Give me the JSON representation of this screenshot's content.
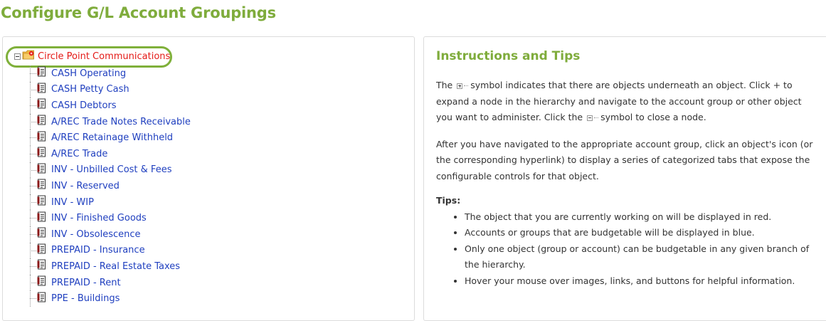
{
  "page": {
    "title": "Configure G/L Account Groupings"
  },
  "tree": {
    "root_label": "Circle Point Communications",
    "items": [
      "CASH Operating",
      "CASH Petty Cash",
      "CASH Debtors",
      "A/REC Trade Notes Receivable",
      "A/REC Retainage Withheld",
      "A/REC Trade",
      "INV - Unbilled Cost & Fees",
      "INV - Reserved",
      "INV - WIP",
      "INV - Finished Goods",
      "INV - Obsolescence",
      "PREPAID - Insurance",
      "PREPAID - Real Estate Taxes",
      "PREPAID - Rent",
      "PPE - Buildings"
    ]
  },
  "instructions": {
    "title": "Instructions and Tips",
    "p1_a": "The",
    "p1_b": "symbol indicates that there are objects underneath an object. Click + to expand a node in the hierarchy and navigate to the account group or other object you want to administer. Click the",
    "p1_c": "symbol to close a node.",
    "p2": "After you have navigated to the appropriate account group, click an object's icon (or the corresponding hyperlink) to display a series of categorized tabs that expose the configurable controls for that object.",
    "tips_heading": "Tips:",
    "tips": [
      "The object that you are currently working on will be displayed in red.",
      "Accounts or groups that are budgetable will be displayed in blue.",
      "Only one object (group or account) can be budgetable in any given branch of the hierarchy.",
      "Hover your mouse over images, links, and buttons for helpful information."
    ]
  },
  "colors": {
    "accent_green": "#7fac3c",
    "current_red": "#e41b17",
    "budgetable_blue": "#1f3fbf"
  }
}
